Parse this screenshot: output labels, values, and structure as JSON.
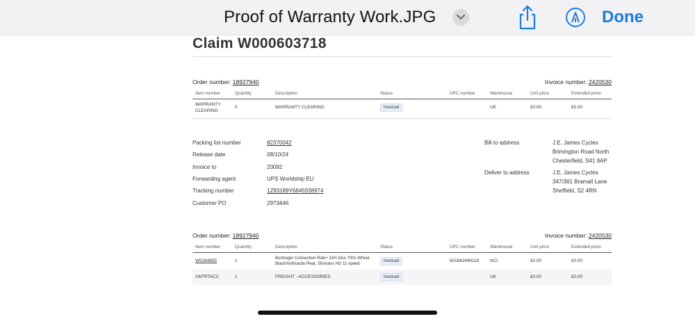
{
  "topbar": {
    "title": "Proof of Warranty Work.JPG",
    "done_label": "Done",
    "icons": [
      "chevron-down-icon",
      "share-icon",
      "markup-icon"
    ]
  },
  "doc": {
    "claim_title": "Claim W000603718",
    "order1": {
      "order_label": "Order number:",
      "order_value": "18927940",
      "invoice_label": "Invoice number:",
      "invoice_value": "2420530",
      "headers": [
        "Item number",
        "Quantity",
        "Description",
        "Status",
        "UPC number",
        "Warehouse",
        "Unit price",
        "Extended price"
      ],
      "rows": [
        {
          "item": "WARRANTY CLEARING",
          "qty": "0",
          "desc": "WARRANTY CLEARING",
          "status": "Invoiced",
          "upc": "",
          "warehouse": "UK",
          "unit": "£0.00",
          "ext": "£0.00"
        }
      ]
    },
    "details": {
      "packing_label": "Packing list number",
      "packing_value": "82370042",
      "release_label": "Release date",
      "release_value": "08/10/24",
      "invoice_to_label": "Invoice to",
      "invoice_to_value": "20092",
      "forwarding_label": "Forwarding agent",
      "forwarding_value": "UPS Worldship EU",
      "tracking_label": "Tracking number",
      "tracking_value": "1Z83189Y6845938974",
      "po_label": "Customer PO",
      "po_value": "2973446",
      "bill_label": "Bill to address",
      "bill_lines": [
        "J.E. James Cycles",
        "Brimington Road North",
        "Chesterfield,  S41 9AP"
      ],
      "deliver_label": "Deliver to address",
      "deliver_lines": [
        "J.E. James Cycles",
        "347/361 Bramall Lane",
        "Sheffield,  S2 4RN"
      ]
    },
    "order2": {
      "order_label": "Order number:",
      "order_value": "18927940",
      "invoice_label": "Invoice number:",
      "invoice_value": "2420530",
      "headers": [
        "Item number",
        "Quantity",
        "Description",
        "Status",
        "UPC number",
        "Warehouse",
        "Unit price",
        "Extended price"
      ],
      "rows": [
        {
          "item": "W5284855",
          "qty": "1",
          "desc": "Bontrager Connection Ride+ 32H Disc 700c Wheel, Black/Anthracite Rear, Shimano HG 11-speed",
          "status": "Invoiced",
          "upc": "601842849118",
          "warehouse": "NCI",
          "unit": "£0.00",
          "ext": "£0.00"
        },
        {
          "item": "UKFRTACC",
          "qty": "1",
          "desc": "FREIGHT - ACCESSORIES",
          "status": "Invoiced",
          "upc": "",
          "warehouse": "UK",
          "unit": "£0.00",
          "ext": "£0.00"
        }
      ]
    }
  }
}
